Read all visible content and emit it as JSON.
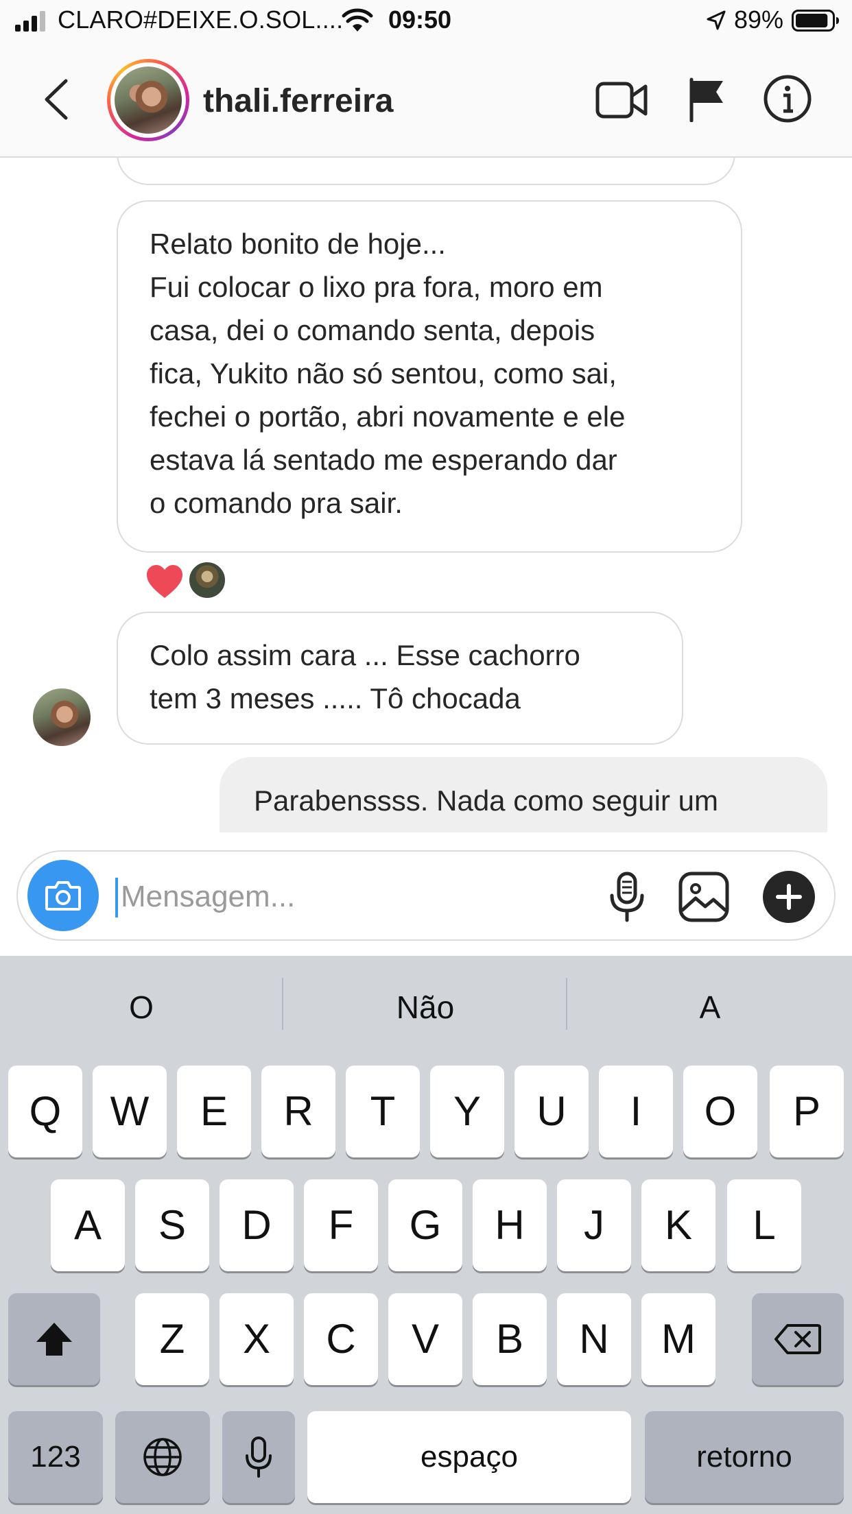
{
  "status_bar": {
    "carrier": "CLARO#DEIXE.O.SOL....",
    "time": "09:50",
    "battery_percent": "89%",
    "battery_level": 0.89
  },
  "header": {
    "username": "thali.ferreira",
    "icons": [
      "back-icon",
      "video-call-icon",
      "flag-icon",
      "info-icon"
    ]
  },
  "messages": [
    {
      "sender": "them",
      "first_line": "Relato bonito de hoje...",
      "lines": [
        "Fui colocar o lixo pra fora, moro em",
        "casa, dei o comando senta, depois",
        "fica, Yukito não só sentou, como sai,",
        "fechei o portão, abri novamente e ele",
        "estava lá sentado me esperando dar",
        "o comando pra sair."
      ],
      "reactions": [
        "heart-icon"
      ]
    },
    {
      "sender": "them",
      "lines": [
        "Colo assim cara ... Esse cachorro",
        "tem 3 meses ..... Tô chocada"
      ]
    },
    {
      "sender": "me",
      "lines": [
        "Parabenssss. Nada como seguir um"
      ]
    }
  ],
  "composer": {
    "placeholder": "Mensagem...",
    "icons": [
      "camera-icon",
      "microphone-icon",
      "gallery-icon",
      "plus-icon"
    ]
  },
  "keyboard": {
    "suggestions": [
      "O",
      "Não",
      "A"
    ],
    "row1": [
      "Q",
      "W",
      "E",
      "R",
      "T",
      "Y",
      "U",
      "I",
      "O",
      "P"
    ],
    "row2": [
      "A",
      "S",
      "D",
      "F",
      "G",
      "H",
      "J",
      "K",
      "L"
    ],
    "row3": [
      "Z",
      "X",
      "C",
      "V",
      "B",
      "N",
      "M"
    ],
    "numbers_key": "123",
    "space_key": "espaço",
    "return_key": "retorno"
  },
  "colors": {
    "accent_blue": "#3897f0",
    "heart_red": "#ed4956",
    "keyboard_bg": "#d1d4d9"
  }
}
